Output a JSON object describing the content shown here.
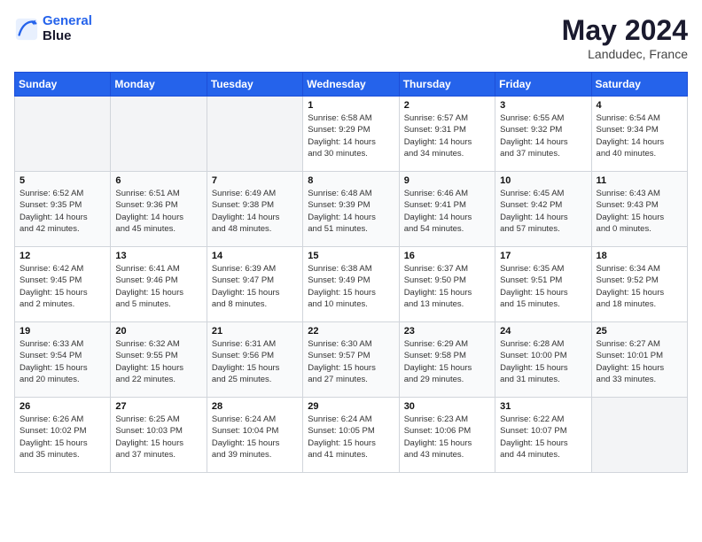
{
  "header": {
    "logo_line1": "General",
    "logo_line2": "Blue",
    "month": "May 2024",
    "location": "Landudec, France"
  },
  "weekdays": [
    "Sunday",
    "Monday",
    "Tuesday",
    "Wednesday",
    "Thursday",
    "Friday",
    "Saturday"
  ],
  "weeks": [
    [
      {
        "day": "",
        "info": ""
      },
      {
        "day": "",
        "info": ""
      },
      {
        "day": "",
        "info": ""
      },
      {
        "day": "1",
        "info": "Sunrise: 6:58 AM\nSunset: 9:29 PM\nDaylight: 14 hours\nand 30 minutes."
      },
      {
        "day": "2",
        "info": "Sunrise: 6:57 AM\nSunset: 9:31 PM\nDaylight: 14 hours\nand 34 minutes."
      },
      {
        "day": "3",
        "info": "Sunrise: 6:55 AM\nSunset: 9:32 PM\nDaylight: 14 hours\nand 37 minutes."
      },
      {
        "day": "4",
        "info": "Sunrise: 6:54 AM\nSunset: 9:34 PM\nDaylight: 14 hours\nand 40 minutes."
      }
    ],
    [
      {
        "day": "5",
        "info": "Sunrise: 6:52 AM\nSunset: 9:35 PM\nDaylight: 14 hours\nand 42 minutes."
      },
      {
        "day": "6",
        "info": "Sunrise: 6:51 AM\nSunset: 9:36 PM\nDaylight: 14 hours\nand 45 minutes."
      },
      {
        "day": "7",
        "info": "Sunrise: 6:49 AM\nSunset: 9:38 PM\nDaylight: 14 hours\nand 48 minutes."
      },
      {
        "day": "8",
        "info": "Sunrise: 6:48 AM\nSunset: 9:39 PM\nDaylight: 14 hours\nand 51 minutes."
      },
      {
        "day": "9",
        "info": "Sunrise: 6:46 AM\nSunset: 9:41 PM\nDaylight: 14 hours\nand 54 minutes."
      },
      {
        "day": "10",
        "info": "Sunrise: 6:45 AM\nSunset: 9:42 PM\nDaylight: 14 hours\nand 57 minutes."
      },
      {
        "day": "11",
        "info": "Sunrise: 6:43 AM\nSunset: 9:43 PM\nDaylight: 15 hours\nand 0 minutes."
      }
    ],
    [
      {
        "day": "12",
        "info": "Sunrise: 6:42 AM\nSunset: 9:45 PM\nDaylight: 15 hours\nand 2 minutes."
      },
      {
        "day": "13",
        "info": "Sunrise: 6:41 AM\nSunset: 9:46 PM\nDaylight: 15 hours\nand 5 minutes."
      },
      {
        "day": "14",
        "info": "Sunrise: 6:39 AM\nSunset: 9:47 PM\nDaylight: 15 hours\nand 8 minutes."
      },
      {
        "day": "15",
        "info": "Sunrise: 6:38 AM\nSunset: 9:49 PM\nDaylight: 15 hours\nand 10 minutes."
      },
      {
        "day": "16",
        "info": "Sunrise: 6:37 AM\nSunset: 9:50 PM\nDaylight: 15 hours\nand 13 minutes."
      },
      {
        "day": "17",
        "info": "Sunrise: 6:35 AM\nSunset: 9:51 PM\nDaylight: 15 hours\nand 15 minutes."
      },
      {
        "day": "18",
        "info": "Sunrise: 6:34 AM\nSunset: 9:52 PM\nDaylight: 15 hours\nand 18 minutes."
      }
    ],
    [
      {
        "day": "19",
        "info": "Sunrise: 6:33 AM\nSunset: 9:54 PM\nDaylight: 15 hours\nand 20 minutes."
      },
      {
        "day": "20",
        "info": "Sunrise: 6:32 AM\nSunset: 9:55 PM\nDaylight: 15 hours\nand 22 minutes."
      },
      {
        "day": "21",
        "info": "Sunrise: 6:31 AM\nSunset: 9:56 PM\nDaylight: 15 hours\nand 25 minutes."
      },
      {
        "day": "22",
        "info": "Sunrise: 6:30 AM\nSunset: 9:57 PM\nDaylight: 15 hours\nand 27 minutes."
      },
      {
        "day": "23",
        "info": "Sunrise: 6:29 AM\nSunset: 9:58 PM\nDaylight: 15 hours\nand 29 minutes."
      },
      {
        "day": "24",
        "info": "Sunrise: 6:28 AM\nSunset: 10:00 PM\nDaylight: 15 hours\nand 31 minutes."
      },
      {
        "day": "25",
        "info": "Sunrise: 6:27 AM\nSunset: 10:01 PM\nDaylight: 15 hours\nand 33 minutes."
      }
    ],
    [
      {
        "day": "26",
        "info": "Sunrise: 6:26 AM\nSunset: 10:02 PM\nDaylight: 15 hours\nand 35 minutes."
      },
      {
        "day": "27",
        "info": "Sunrise: 6:25 AM\nSunset: 10:03 PM\nDaylight: 15 hours\nand 37 minutes."
      },
      {
        "day": "28",
        "info": "Sunrise: 6:24 AM\nSunset: 10:04 PM\nDaylight: 15 hours\nand 39 minutes."
      },
      {
        "day": "29",
        "info": "Sunrise: 6:24 AM\nSunset: 10:05 PM\nDaylight: 15 hours\nand 41 minutes."
      },
      {
        "day": "30",
        "info": "Sunrise: 6:23 AM\nSunset: 10:06 PM\nDaylight: 15 hours\nand 43 minutes."
      },
      {
        "day": "31",
        "info": "Sunrise: 6:22 AM\nSunset: 10:07 PM\nDaylight: 15 hours\nand 44 minutes."
      },
      {
        "day": "",
        "info": ""
      }
    ]
  ]
}
